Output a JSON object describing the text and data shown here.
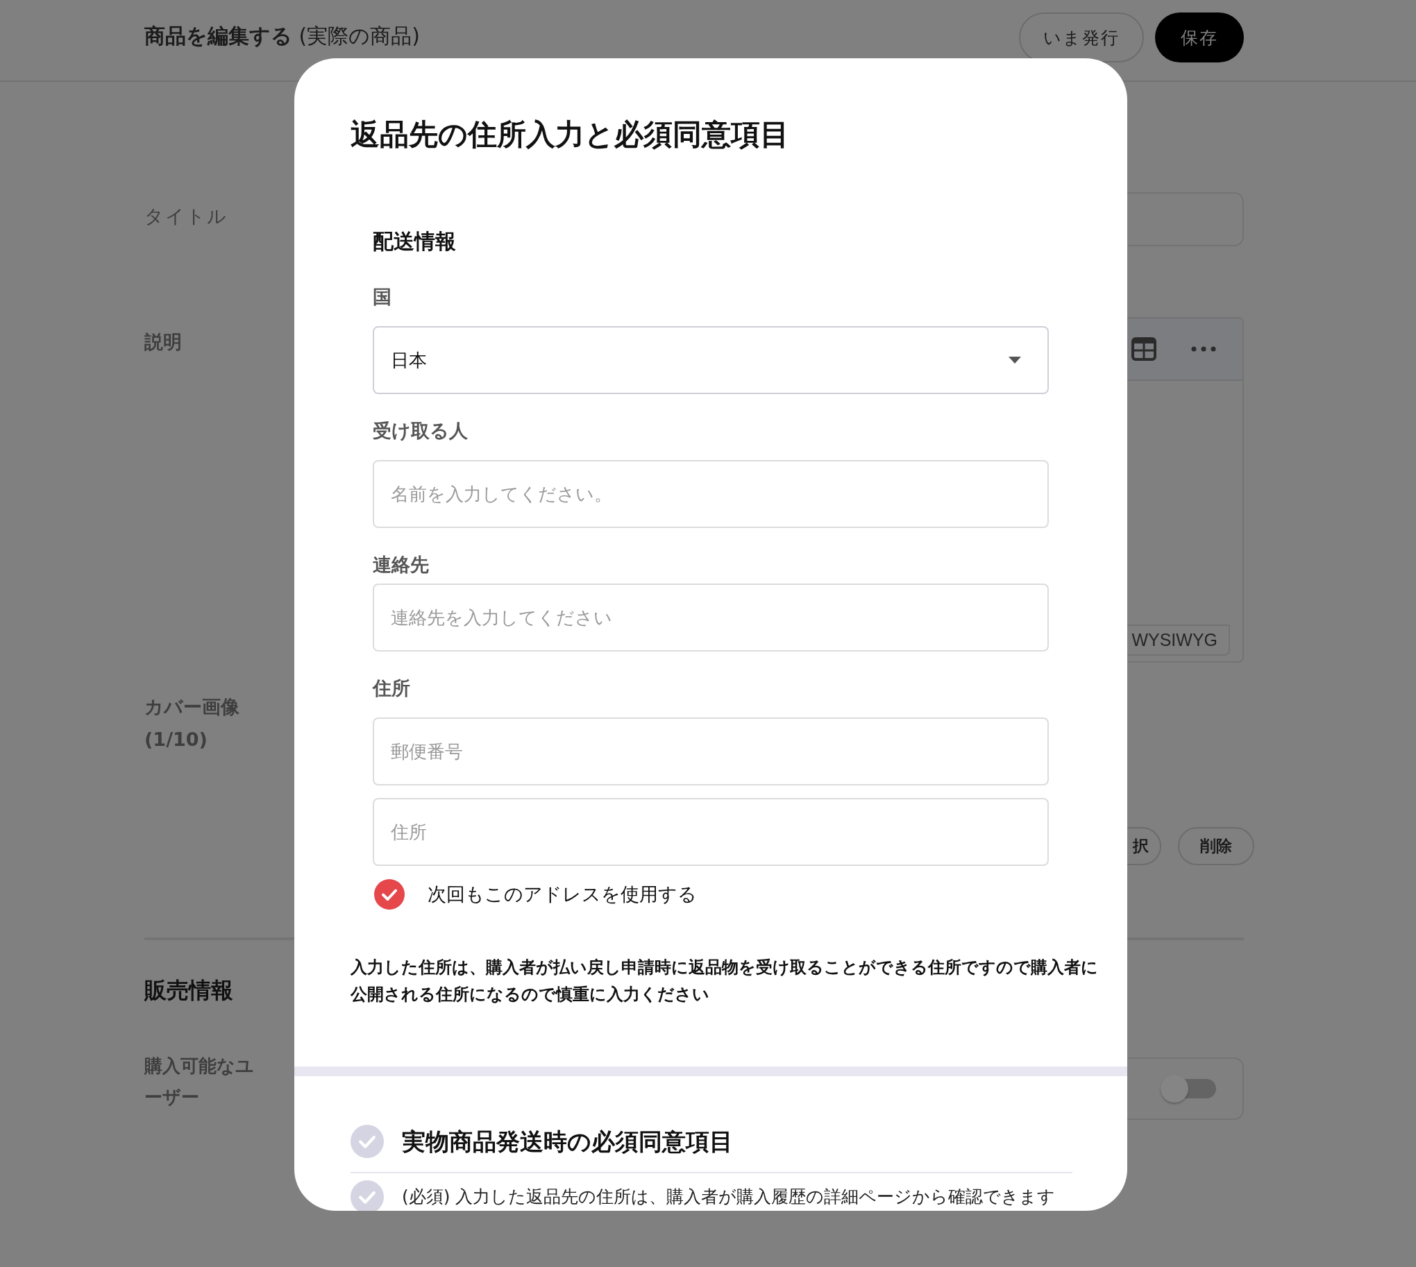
{
  "header": {
    "title": "**商品を編集する** (実際の商品)",
    "buttons": [
      {
        "label": "いま発行",
        "kind": "outline"
      },
      {
        "label": "保存",
        "kind": "filled"
      }
    ]
  },
  "page": {
    "title_label": "タイトル",
    "description_label": "説明",
    "editor_tab": "WYSIWYG",
    "cover_label": "カバー画像\n(1/10)",
    "cover_buttons": [
      "択",
      "削除"
    ],
    "sales_heading": "販売情報",
    "buyers_label": "購入可能なユーザー",
    "buyers_toggle": {
      "on": false
    }
  },
  "modal": {
    "title": "返品先の住所入力と必須同意項目",
    "shipping": {
      "heading": "配送情報",
      "country": {
        "label": "国",
        "value": "日本"
      },
      "recipient": {
        "label": "受け取る人",
        "placeholder": "名前を入力してください。"
      },
      "contact": {
        "label": "連絡先",
        "placeholder": "連絡先を入力してください"
      },
      "address": {
        "label": "住所",
        "fields": [
          {
            "placeholder": "郵便番号"
          },
          {
            "placeholder": "住所"
          }
        ]
      },
      "save_address": {
        "label": "次回もこのアドレスを使用する",
        "checked": true
      }
    },
    "notice": "入力した住所は、購入者が払い戻し申請時に返品物を受け取ることができる住所ですので購入者に公開される住所になるので慎重に入力ください",
    "agreements": {
      "heading": "実物商品発送時の必須同意項目",
      "checked": false,
      "items": [
        {
          "text": "(必須) 入力した返品先の住所は、購入者が購入履歴の詳細ページから確認できます",
          "checked": false
        }
      ]
    }
  }
}
